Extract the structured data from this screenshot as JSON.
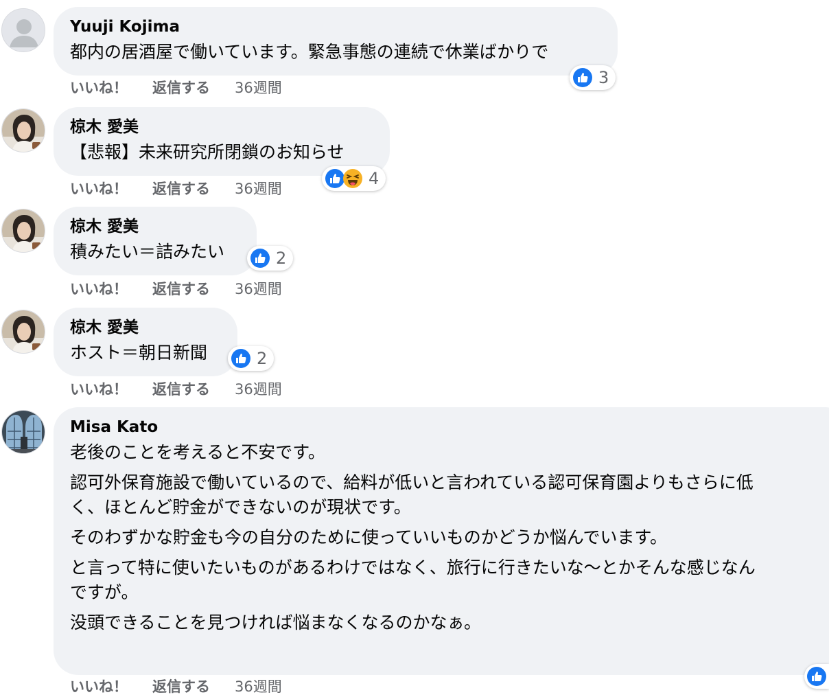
{
  "comments": [
    {
      "author": "Yuuji Kojima",
      "lines": [
        "都内の居酒屋で働いています。緊急事態の連続で休業ばかりで"
      ],
      "reaction_count": "3",
      "like": "いいね！",
      "reply": "返信する",
      "time": "36週間"
    },
    {
      "author": "椋木 愛美",
      "lines": [
        "【悲報】未来研究所閉鎖のお知らせ"
      ],
      "reaction_count": "4",
      "like": "いいね！",
      "reply": "返信する",
      "time": "36週間"
    },
    {
      "author": "椋木 愛美",
      "lines": [
        "積みたい＝詰みたい"
      ],
      "reaction_count": "2",
      "like": "いいね！",
      "reply": "返信する",
      "time": "36週間"
    },
    {
      "author": "椋木 愛美",
      "lines": [
        "ホスト＝朝日新聞"
      ],
      "reaction_count": "2",
      "like": "いいね！",
      "reply": "返信する",
      "time": "36週間"
    },
    {
      "author": "Misa Kato",
      "paragraphs": [
        [
          "老後のことを考えると不安です。"
        ],
        [
          "認可外保育施設で働いているので、給料が低いと言われている認可保育園よりもさらに低",
          "く、ほとんど貯金ができないのが現状です。"
        ],
        [
          "そのわずかな貯金も今の自分のために使っていいものかどうか悩んでいます。"
        ],
        [
          "と言って特に使いたいものがあるわけではなく、旅行に行きたいな〜とかそんな感じなん",
          "ですが。"
        ],
        [
          "没頭できることを見つければ悩まなくなるのかなぁ。"
        ]
      ],
      "like": "いいね！",
      "reply": "返信する",
      "time": "36週間"
    }
  ],
  "icons": {
    "like": "like-reaction-icon",
    "haha": "haha-reaction-icon"
  },
  "colors": {
    "bubble": "#f0f2f5",
    "meta_text": "#65676b",
    "like_blue": "#1877f2"
  }
}
